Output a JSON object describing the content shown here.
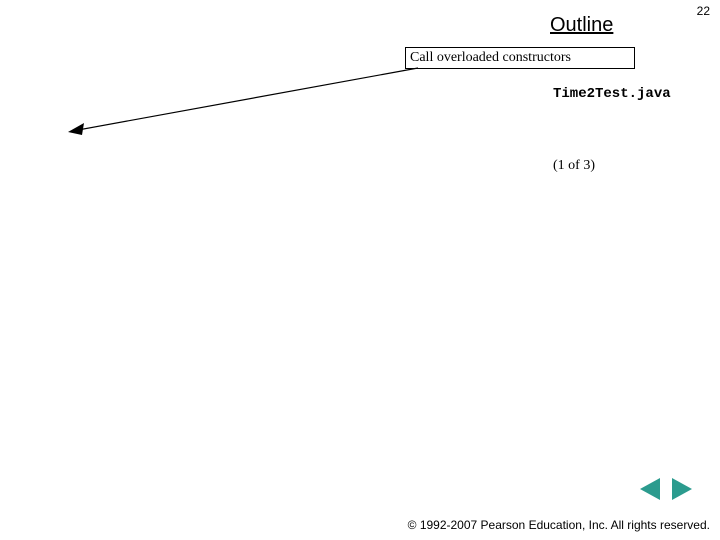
{
  "page_number": "22",
  "heading": "Outline",
  "callout": "Call overloaded constructors",
  "file_label": "Time2Test.java",
  "page_range": "(1 of  3)",
  "copyright": "© 1992-2007 Pearson Education, Inc.  All rights reserved.",
  "nav": {
    "prev_icon": "prev-triangle",
    "next_icon": "next-triangle"
  }
}
